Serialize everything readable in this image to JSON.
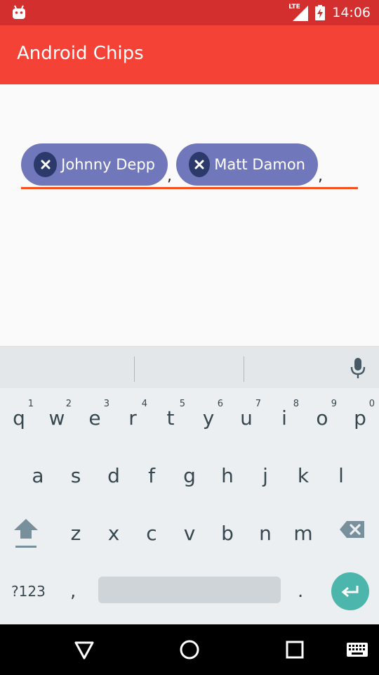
{
  "status_bar": {
    "time": "14:06",
    "network": "LTE",
    "left_icon": "android-icon",
    "battery_icon": "battery-charging-icon",
    "color": "#d32f2f"
  },
  "app_bar": {
    "title": "Android Chips",
    "color": "#f44336"
  },
  "chips_input": {
    "chips": [
      {
        "label": "Johnny Depp",
        "icon": "close-icon"
      },
      {
        "label": "Matt Damon",
        "icon": "close-icon"
      }
    ],
    "separator": ",",
    "chip_color": "#7078bb",
    "underline_color": "#f4511e"
  },
  "keyboard": {
    "suggestions": [
      "",
      "",
      ""
    ],
    "voice_icon": "mic-icon",
    "row1": [
      {
        "key": "q",
        "hint": "1"
      },
      {
        "key": "w",
        "hint": "2"
      },
      {
        "key": "e",
        "hint": "3"
      },
      {
        "key": "r",
        "hint": "4"
      },
      {
        "key": "t",
        "hint": "5"
      },
      {
        "key": "y",
        "hint": "6"
      },
      {
        "key": "u",
        "hint": "7"
      },
      {
        "key": "i",
        "hint": "8"
      },
      {
        "key": "o",
        "hint": "9"
      },
      {
        "key": "p",
        "hint": "0"
      }
    ],
    "row2": [
      "a",
      "s",
      "d",
      "f",
      "g",
      "h",
      "j",
      "k",
      "l"
    ],
    "row3": [
      "z",
      "x",
      "c",
      "v",
      "b",
      "n",
      "m"
    ],
    "shift_icon": "shift-icon",
    "backspace_icon": "backspace-icon",
    "symbols_label": "?123",
    "comma_label": ",",
    "period_label": ".",
    "enter_icon": "enter-icon",
    "enter_color": "#4db6ac"
  },
  "nav_bar": {
    "back_icon": "back-icon",
    "home_icon": "home-icon",
    "recents_icon": "recents-icon",
    "keyboard_icon": "keyboard-icon"
  }
}
